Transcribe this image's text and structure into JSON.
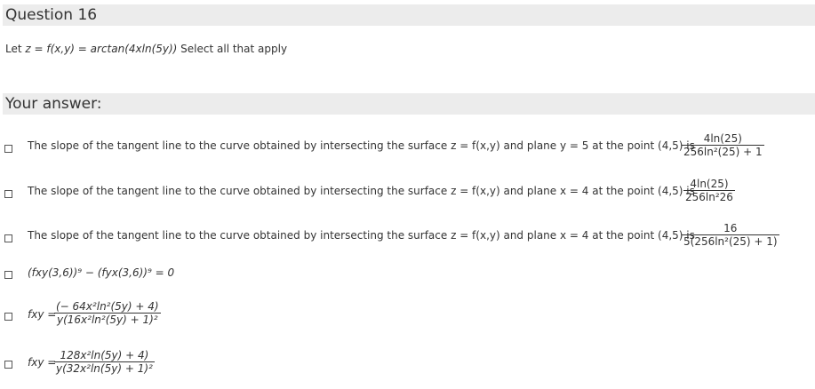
{
  "question": {
    "title": "Question 16"
  },
  "stem": {
    "prefix": "Let ",
    "expr": "z = f(x,y) = arctan(4xln(5y))",
    "suffix": " Select all that apply"
  },
  "answer": {
    "title": "Your answer:"
  },
  "options": [
    {
      "text": "The slope of the tangent line to the curve obtained by intersecting the surface z = f(x,y) and plane y = 5 at the point (4,5) is",
      "num": "4ln(25)",
      "den": "256ln²(25) + 1"
    },
    {
      "text": "The slope of the tangent line to the curve obtained by intersecting the surface z = f(x,y) and plane x = 4 at the point (4,5) is",
      "num": "4ln(25)",
      "den": "256ln²26"
    },
    {
      "text": "The slope of the tangent line to the curve obtained by intersecting the surface z = f(x,y) and plane x = 4 at the point (4,5) is",
      "num": "16",
      "den": "5(256ln²(25) + 1)"
    },
    {
      "expr": "(fxy(3,6))⁹ − (fyx(3,6))⁹ = 0"
    },
    {
      "lhs": "fxy =",
      "num": "(− 64x²ln²(5y) + 4)",
      "den": "y(16x²ln²(5y) + 1)²"
    },
    {
      "lhs": "fxy =",
      "num": "128x²ln(5y) + 4)",
      "den": "y(32x²ln(5y) + 1)²"
    }
  ]
}
